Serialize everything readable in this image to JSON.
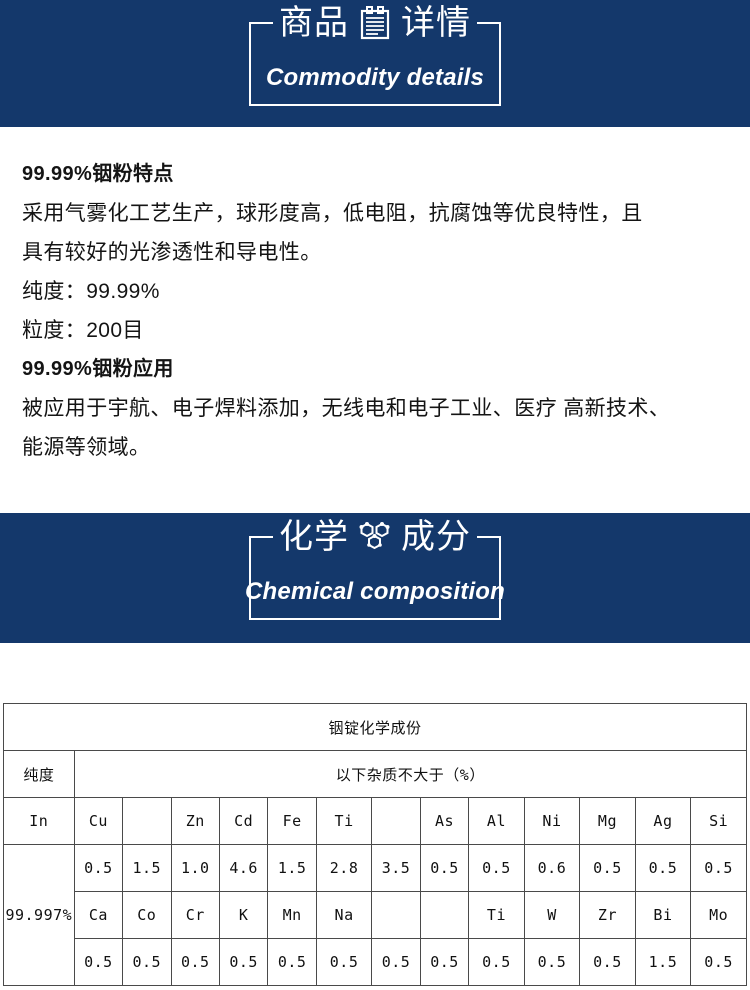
{
  "theme": {
    "banner_bg": "#14386B",
    "banner_text": "#FFFFFF",
    "body_text": "#141414",
    "table_border": "#4A4A4A"
  },
  "banners": [
    {
      "id": "commodity",
      "title_cn_left": "商品",
      "title_cn_right": "详情",
      "icon": "clipboard-icon",
      "title_en": "Commodity details"
    },
    {
      "id": "chemical",
      "title_cn_left": "化学",
      "title_cn_right": "成分",
      "icon": "molecule-hexagon-icon",
      "title_en": "Chemical composition"
    }
  ],
  "content": {
    "heading_1": "99.99%铟粉特点",
    "line_1": "采用气雾化工艺生产，球形度高，低电阻，抗腐蚀等优良特性，且",
    "line_2": "具有较好的光渗透性和导电性。",
    "line_3": "纯度：99.99%",
    "line_4": "粒度：200目",
    "heading_2": "99.99%铟粉应用",
    "line_5": "被应用于宇航、电子焊料添加，无线电和电子工业、医疗 高新技术、",
    "line_6": "能源等领域。"
  },
  "table": {
    "title": "铟锭化学成份",
    "purity_header": "纯度",
    "impurity_header": "以下杂质不大于（%）",
    "purity_value": "99.997%",
    "base_element": "In",
    "row_symbols_1": [
      "Cu",
      "",
      "Zn",
      "Cd",
      "Fe",
      "Ti",
      "",
      "As",
      "Al",
      "Ni",
      "Mg",
      "Ag",
      "Si"
    ],
    "row_values_1": [
      "0.5",
      "1.5",
      "1.0",
      "4.6",
      "1.5",
      "2.8",
      "3.5",
      "0.5",
      "0.5",
      "0.6",
      "0.5",
      "0.5",
      "0.5"
    ],
    "row_symbols_2": [
      "Ca",
      "Co",
      "Cr",
      "K",
      "Mn",
      "Na",
      "",
      "",
      "Ti",
      "W",
      "Zr",
      "Bi",
      "Mo"
    ],
    "row_values_2": [
      "0.5",
      "0.5",
      "0.5",
      "0.5",
      "0.5",
      "0.5",
      "0.5",
      "0.5",
      "0.5",
      "0.5",
      "0.5",
      "1.5",
      "0.5"
    ]
  }
}
